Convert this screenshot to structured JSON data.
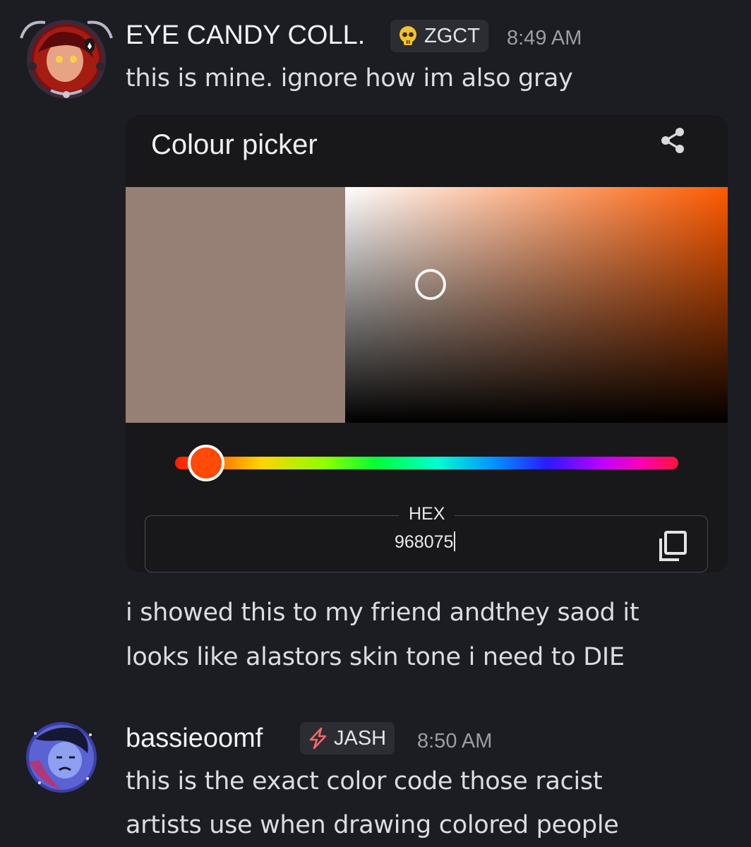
{
  "message1": {
    "author": "EYE CANDY COLL.",
    "tag": {
      "icon": "skull-icon",
      "label": "ZGCT"
    },
    "time": "8:49 AM",
    "text": "this is mine. ignore how im also gray"
  },
  "colour_picker": {
    "title": "Colour picker",
    "share_icon": "share-icon",
    "selected_color": "#968075",
    "hue_color": "#ff5a00",
    "hue_position": 0.06,
    "hex_label": "HEX",
    "hex_value": "968075",
    "copy_icon": "copy-icon"
  },
  "message1_followup": {
    "line1": "i showed this to my friend andthey saod it",
    "line2": "looks like alastors skin tone i need to DIE"
  },
  "message2": {
    "author": "bassieoomf",
    "tag": {
      "icon": "lightning-icon",
      "label": "JASH"
    },
    "time": "8:50 AM",
    "line1": "this is the exact color code those racist",
    "line2": "artists use when drawing colored people"
  },
  "colors": {
    "background": "#1c1d22",
    "card": "#18181a",
    "tag_bg": "#2b2d33"
  }
}
